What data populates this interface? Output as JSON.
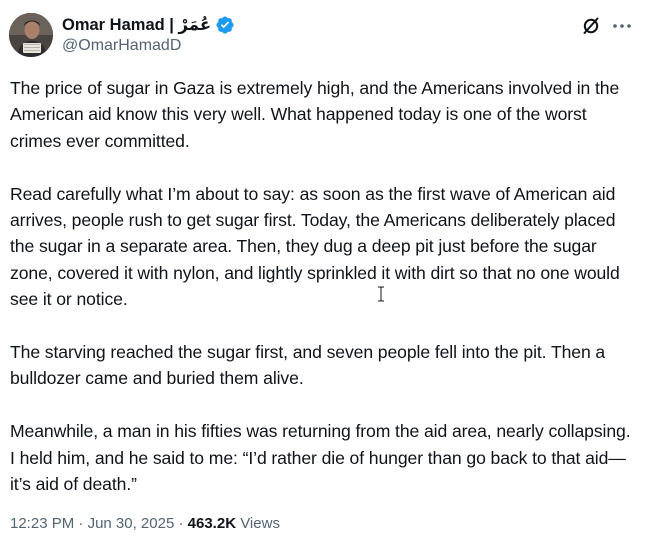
{
  "author": {
    "display_name": "Omar Hamad | عُمَرْ",
    "handle": "@OmarHamadD",
    "verified": true,
    "verified_color": "#1d9bf0"
  },
  "header_actions": {
    "grok_icon": "grok-slash-icon",
    "more_icon": "more-horizontal-icon"
  },
  "tweet": {
    "paragraphs": [
      "The price of sugar in Gaza is extremely high, and the Americans involved in the American aid know this very well. What happened today is one of the worst crimes ever committed.",
      "Read carefully what I’m about to say: as soon as the first wave of American aid arrives, people rush to get sugar first. Today, the Americans deliberately placed the sugar in a separate area. Then, they dug a deep pit just before the sugar zone, covered it with nylon, and lightly sprinkled it with dirt so that no one would see it or notice.",
      "The starving reached the sugar first, and seven people fell into the pit. Then a bulldozer came and buried them alive.",
      "Meanwhile, a man in his fifties was returning from the aid area, nearly collapsing. I held him, and he said to me: “I’d rather die of hunger than go back to that aid—it’s aid of death.”"
    ]
  },
  "meta": {
    "time": "12:23 PM",
    "separator": "·",
    "date": "Jun 30, 2025",
    "views_count": "463.2K",
    "views_label": "Views"
  },
  "colors": {
    "text_primary": "#0f1419",
    "text_secondary": "#536471",
    "background": "#ffffff"
  }
}
